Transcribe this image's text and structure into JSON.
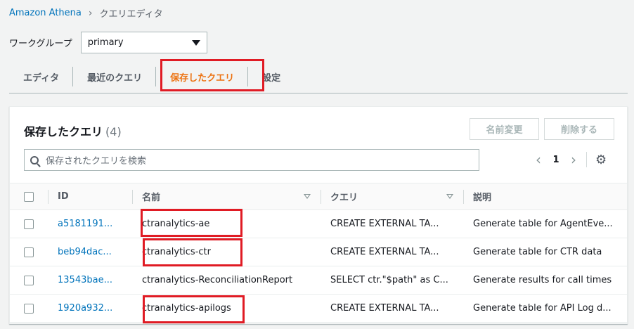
{
  "breadcrumb": {
    "root": "Amazon Athena",
    "current": "クエリエディタ"
  },
  "workgroup": {
    "label": "ワークグループ",
    "value": "primary"
  },
  "tabs": [
    {
      "label": "エディタ"
    },
    {
      "label": "最近のクエリ"
    },
    {
      "label": "保存したクエリ"
    },
    {
      "label": "設定"
    }
  ],
  "panel": {
    "title": "保存したクエリ",
    "count": "(4)",
    "rename_label": "名前変更",
    "delete_label": "削除する",
    "search_placeholder": "保存されたクエリを検索",
    "page": "1"
  },
  "table": {
    "columns": {
      "id": "ID",
      "name": "名前",
      "query": "クエリ",
      "description": "説明"
    },
    "rows": [
      {
        "id": "a5181191...",
        "name": "ctranalytics-ae",
        "query": "CREATE EXTERNAL TA...",
        "description": "Generate table for AgentEve..."
      },
      {
        "id": "beb94dac...",
        "name": "ctranalytics-ctr",
        "query": "CREATE EXTERNAL TA...",
        "description": "Generate table for CTR data"
      },
      {
        "id": "13543bae...",
        "name": "ctranalytics-ReconciliationReport",
        "query": "SELECT ctr.\"$path\" as C...",
        "description": "Generate results for call times"
      },
      {
        "id": "1920a932...",
        "name": "ctranalytics-apilogs",
        "query": "CREATE EXTERNAL TA...",
        "description": "Generate table for API Log d..."
      }
    ]
  },
  "colors": {
    "accent": "#ec7211",
    "link": "#0073bb",
    "highlight": "#e01b24"
  }
}
